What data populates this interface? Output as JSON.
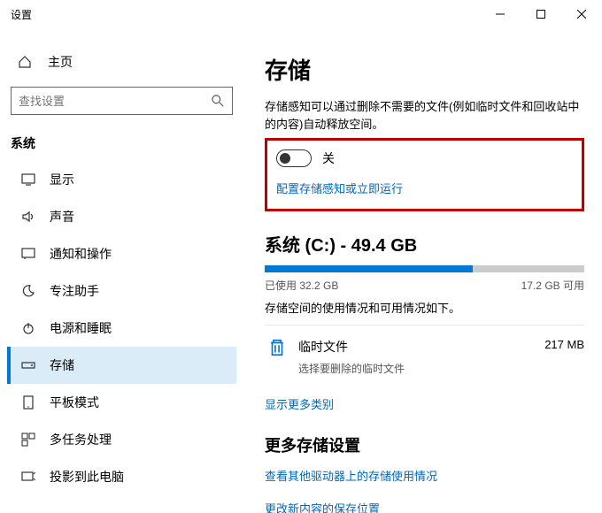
{
  "window": {
    "title": "设置"
  },
  "sidebar": {
    "home": "主页",
    "search_placeholder": "查找设置",
    "section": "系统",
    "items": [
      {
        "label": "显示"
      },
      {
        "label": "声音"
      },
      {
        "label": "通知和操作"
      },
      {
        "label": "专注助手"
      },
      {
        "label": "电源和睡眠"
      },
      {
        "label": "存储"
      },
      {
        "label": "平板模式"
      },
      {
        "label": "多任务处理"
      },
      {
        "label": "投影到此电脑"
      }
    ]
  },
  "main": {
    "title": "存储",
    "description": "存储感知可以通过删除不需要的文件(例如临时文件和回收站中的内容)自动释放空间。",
    "toggle_state": "关",
    "configure_link": "配置存储感知或立即运行",
    "drive": {
      "title": "系统 (C:) - 49.4 GB",
      "used_label": "已使用 32.2 GB",
      "free_label": "17.2 GB 可用",
      "used_pct": 65,
      "free_pct": 35
    },
    "usage_hint": "存储空间的使用情况和可用情况如下。",
    "category": {
      "name": "临时文件",
      "desc": "选择要删除的临时文件",
      "size": "217 MB"
    },
    "show_more": "显示更多类别",
    "more_heading": "更多存储设置",
    "link_other_drives": "查看其他驱动器上的存储使用情况",
    "link_change_save": "更改新内容的保存位置"
  }
}
